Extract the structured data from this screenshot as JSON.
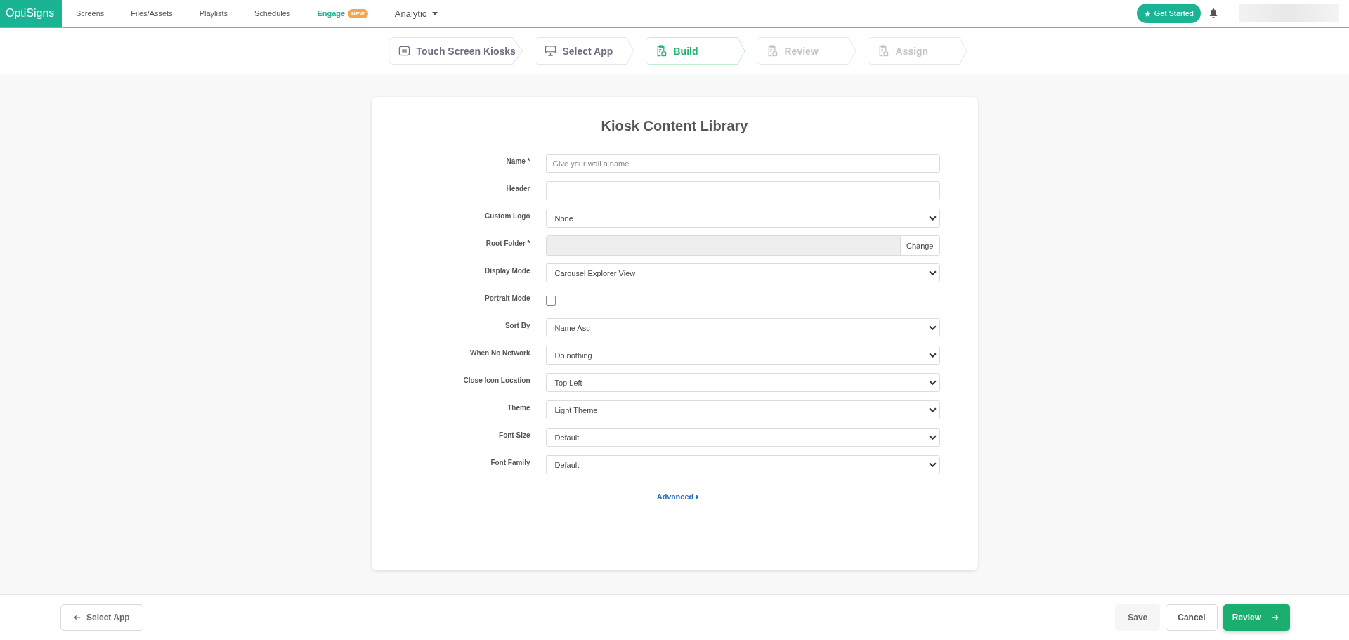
{
  "brand": "OptiSigns",
  "nav": [
    {
      "label": "Screens",
      "accent": false,
      "dropdown": false
    },
    {
      "label": "Files/Assets",
      "accent": false,
      "dropdown": false
    },
    {
      "label": "Playlists",
      "accent": false,
      "dropdown": false
    },
    {
      "label": "Schedules",
      "accent": false,
      "dropdown": false
    },
    {
      "label": "Engage",
      "accent": true,
      "badge": "NEW",
      "dropdown": false
    },
    {
      "label": "Analytic",
      "accent": false,
      "dropdown": true
    }
  ],
  "get_started": "Get Started",
  "steps": [
    {
      "label": "Touch Screen Kiosks",
      "selected": false,
      "disabled": false
    },
    {
      "label": "Select App",
      "selected": false,
      "disabled": false
    },
    {
      "label": "Build",
      "selected": true,
      "disabled": false
    },
    {
      "label": "Review",
      "selected": false,
      "disabled": true
    },
    {
      "label": "Assign",
      "selected": false,
      "disabled": true
    }
  ],
  "title": "Kiosk Content Library",
  "fields": [
    {
      "label": "Name *",
      "kind": "text",
      "placeholder": "Give your wall a name"
    },
    {
      "label": "Header",
      "kind": "text"
    },
    {
      "label": "Custom Logo",
      "kind": "select",
      "value": "None"
    },
    {
      "label": "Root Folder *",
      "kind": "folder",
      "button": "Change"
    },
    {
      "label": "Display Mode",
      "kind": "select",
      "value": "Carousel Explorer View"
    },
    {
      "label": "Portrait Mode",
      "kind": "checkbox",
      "checked": false
    },
    {
      "label": "Sort By",
      "kind": "select",
      "value": "Name Asc"
    },
    {
      "label": "When No Network",
      "kind": "select",
      "value": "Do nothing"
    },
    {
      "label": "Close Icon Location",
      "kind": "select",
      "value": "Top Left"
    },
    {
      "label": "Theme",
      "kind": "select",
      "value": "Light Theme"
    },
    {
      "label": "Font Size",
      "kind": "select",
      "value": "Default"
    },
    {
      "label": "Font Family",
      "kind": "select",
      "value": "Default"
    }
  ],
  "advanced": "Advanced",
  "footer": {
    "back": "Select App",
    "save": "Save",
    "cancel": "Cancel",
    "next": "Review"
  }
}
